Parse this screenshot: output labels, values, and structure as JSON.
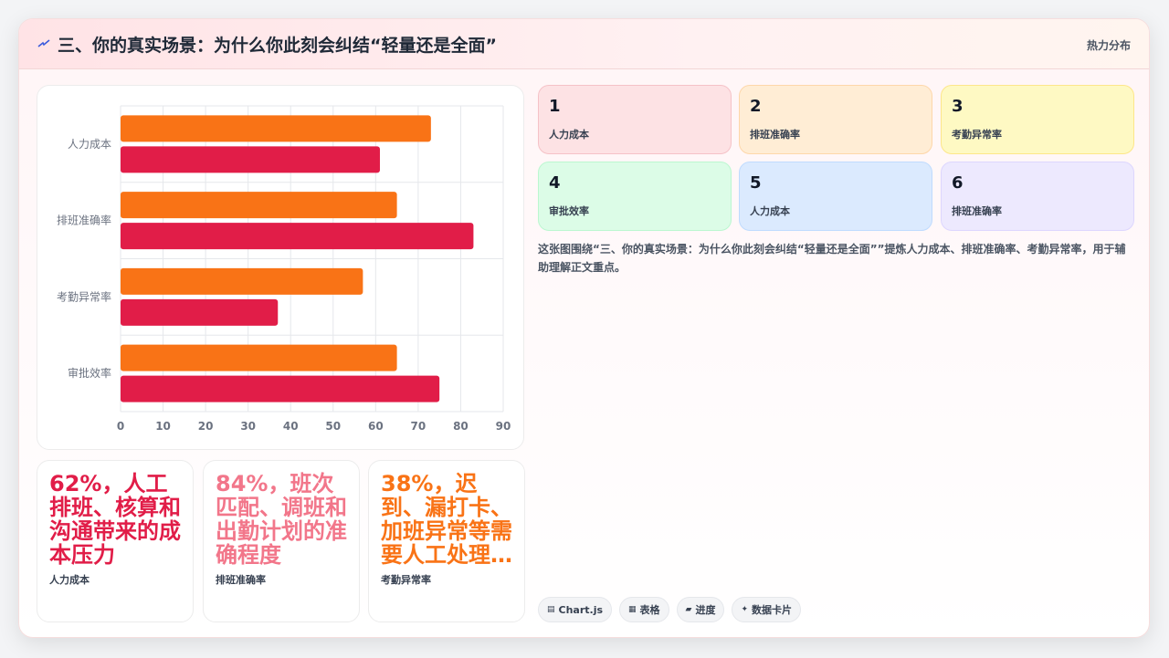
{
  "header": {
    "title": "三、你的真实场景：为什么你此刻会纠结“轻量还是全面”",
    "tag": "热力分布"
  },
  "colors": {
    "orange": "#f97316",
    "crimson": "#e11d48",
    "pink": "#f2768a",
    "grid": "#e5e7eb",
    "axis_text": "#6b7280"
  },
  "chart_data": {
    "type": "bar",
    "orientation": "horizontal",
    "categories": [
      "人力成本",
      "排班准确率",
      "考勤异常率",
      "审批效率"
    ],
    "series": [
      {
        "values": [
          73,
          65,
          57,
          65
        ],
        "color": "#f97316"
      },
      {
        "values": [
          61,
          83,
          37,
          75
        ],
        "color": "#e11d48"
      }
    ],
    "xlim": [
      0,
      90
    ],
    "xticks": [
      0,
      10,
      20,
      30,
      40,
      50,
      60,
      70,
      80,
      90
    ],
    "grid": true,
    "legend": "none"
  },
  "stats": [
    {
      "big": "62%，人工排班、核算和沟通带来的成本压力",
      "small": "人力成本",
      "color": "#e11d48"
    },
    {
      "big": "84%，班次匹配、调班和出勤计划的准确程度",
      "small": "排班准确率",
      "color": "#f2768a"
    },
    {
      "big": "38%，迟到、漏打卡、加班异常等需要人工处理…",
      "small": "考勤异常率",
      "color": "#f97316"
    }
  ],
  "tiles": [
    {
      "num": "1",
      "label": "人力成本",
      "bg": "#fde2e4",
      "border": "#f5c2c7"
    },
    {
      "num": "2",
      "label": "排班准确率",
      "bg": "#ffedd5",
      "border": "#fed7aa"
    },
    {
      "num": "3",
      "label": "考勤异常率",
      "bg": "#fef9c3",
      "border": "#fde68a"
    },
    {
      "num": "4",
      "label": "审批效率",
      "bg": "#dcfce7",
      "border": "#bbf7d0"
    },
    {
      "num": "5",
      "label": "人力成本",
      "bg": "#dbeafe",
      "border": "#bfdbfe"
    },
    {
      "num": "6",
      "label": "排班准确率",
      "bg": "#ede9fe",
      "border": "#ddd6fe"
    }
  ],
  "description": "这张图围绕“三、你的真实场景：为什么你此刻会纠结“轻量还是全面””提炼人力成本、排班准确率、考勤异常率，用于辅助理解正文重点。",
  "chips": [
    {
      "icon": "▤",
      "label": "Chart.js"
    },
    {
      "icon": "▦",
      "label": "表格"
    },
    {
      "icon": "▰",
      "label": "进度"
    },
    {
      "icon": "✦",
      "label": "数据卡片"
    }
  ]
}
